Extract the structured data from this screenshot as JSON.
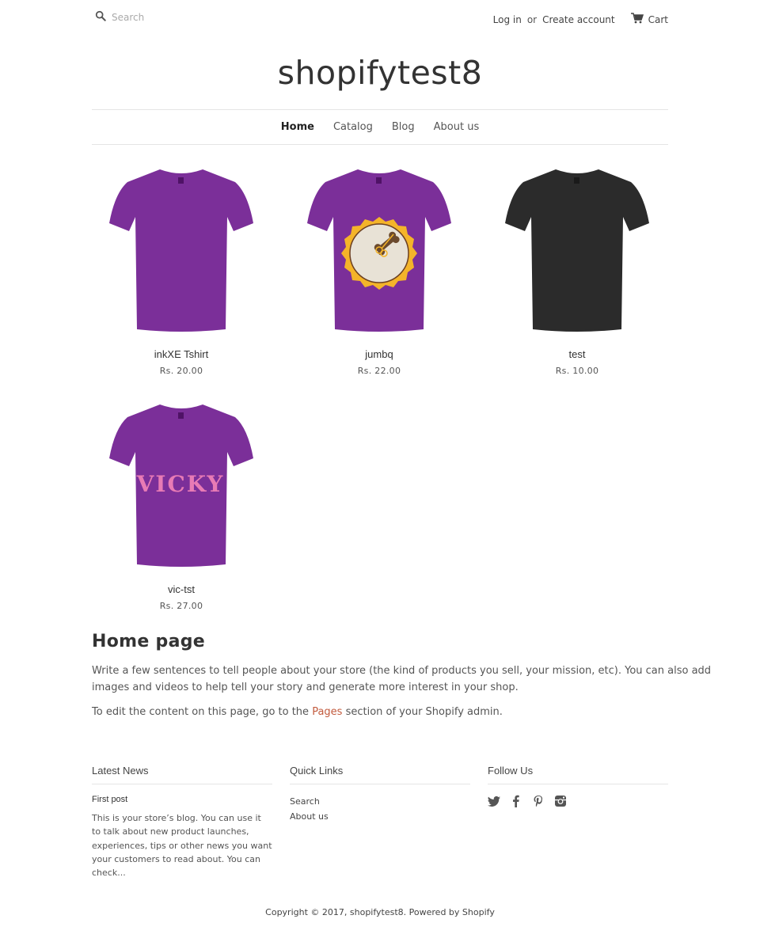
{
  "header": {
    "search_placeholder": "Search",
    "search_icon": "search-icon",
    "login_label": "Log in",
    "or_label": "or",
    "create_account_label": "Create account",
    "cart_icon": "cart-icon",
    "cart_label": "Cart"
  },
  "store": {
    "name": "shopifytest8"
  },
  "nav": {
    "items": [
      {
        "label": "Home",
        "active": true
      },
      {
        "label": "Catalog",
        "active": false
      },
      {
        "label": "Blog",
        "active": false
      },
      {
        "label": "About us",
        "active": false
      }
    ]
  },
  "products": [
    {
      "title": "inkXE Tshirt",
      "price": "Rs. 20.00",
      "shirt_color": "#7b2f99",
      "print": "none"
    },
    {
      "title": "jumbq",
      "price": "Rs. 22.00",
      "shirt_color": "#7b2f99",
      "print": "badge"
    },
    {
      "title": "test",
      "price": "Rs. 10.00",
      "shirt_color": "#2b2b2b",
      "print": "none"
    },
    {
      "title": "vic-tst",
      "price": "Rs. 27.00",
      "shirt_color": "#7b2f99",
      "print": "VICKY"
    }
  ],
  "home": {
    "heading": "Home page",
    "paragraph1": "Write a few sentences to tell people about your store (the kind of products you sell, your mission, etc). You can also add images and videos to help tell your story and generate more interest in your shop.",
    "paragraph2_before": "To edit the content on this page, go to the ",
    "paragraph2_link": "Pages",
    "paragraph2_after": " section of your Shopify admin."
  },
  "footer": {
    "latest_news": {
      "heading": "Latest News",
      "post_title": "First post",
      "post_excerpt": "This is your store’s blog. You can use it to talk about new product launches, experiences, tips or other news you want your customers to read about. You can check..."
    },
    "quick_links": {
      "heading": "Quick Links",
      "items": [
        "Search",
        "About us"
      ]
    },
    "follow_us": {
      "heading": "Follow Us",
      "icons": [
        "twitter-icon",
        "facebook-icon",
        "pinterest-icon",
        "instagram-icon"
      ]
    },
    "copyright": "Copyright © 2017, shopifytest8. Powered by Shopify"
  },
  "colors": {
    "text": "#333333",
    "link_accent": "#c25a3d",
    "border": "#e5e5e5",
    "purple_shirt": "#7b2f99",
    "black_shirt": "#2b2b2b",
    "badge_yellow": "#f4b42a",
    "badge_cream": "#e8e2d6",
    "vicky_pink": "#e87bb5"
  }
}
